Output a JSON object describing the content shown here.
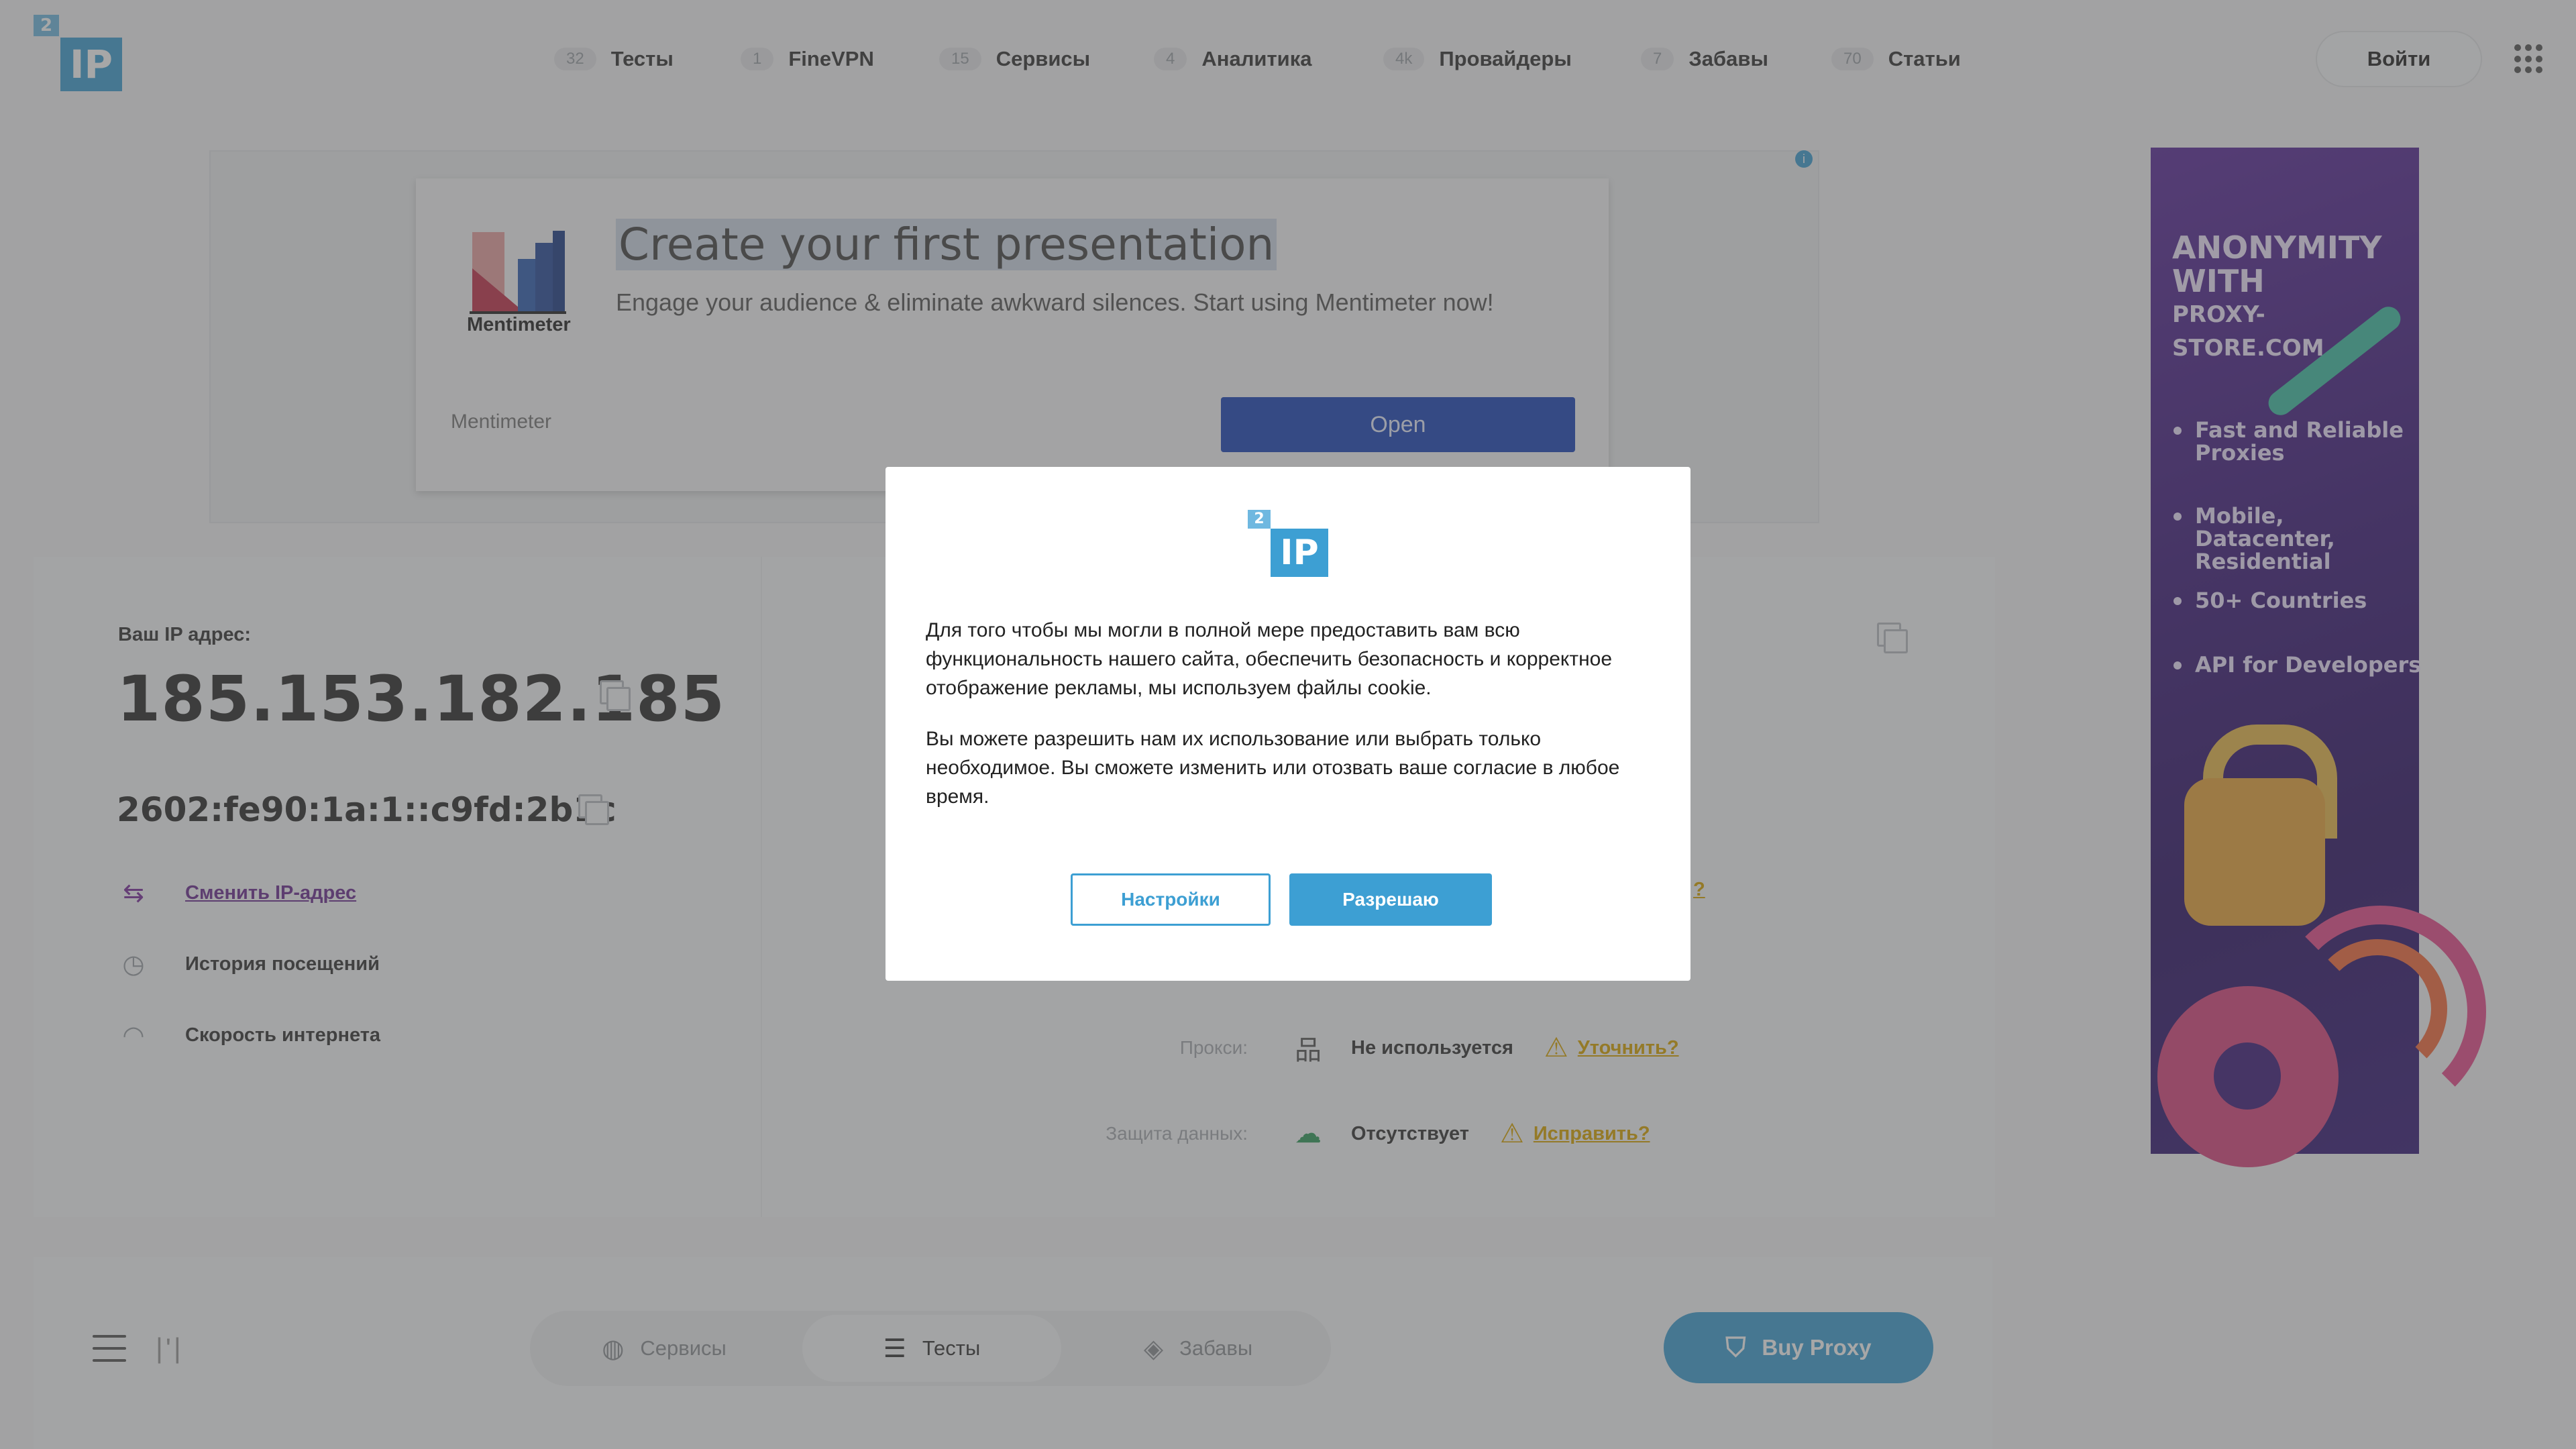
{
  "header": {
    "logo": {
      "superscript": "2",
      "mark": "IP"
    },
    "nav": [
      {
        "count": "32",
        "label": "Тесты"
      },
      {
        "count": "1",
        "label": "FineVPN"
      },
      {
        "count": "15",
        "label": "Сервисы"
      },
      {
        "count": "4",
        "label": "Аналитика"
      },
      {
        "count": "4k",
        "label": "Провайдеры"
      },
      {
        "count": "7",
        "label": "Забавы"
      },
      {
        "count": "70",
        "label": "Статьи"
      }
    ],
    "login_label": "Войти",
    "menu_icon": "grid-dots-icon"
  },
  "ad_top": {
    "title": "Create your first presentation",
    "description": "Engage your audience & eliminate awkward silences. Start using Mentimeter now!",
    "brand": "Mentimeter",
    "logo_text": "Mentimeter",
    "cta": "Open",
    "info_icon": "i"
  },
  "ip_card": {
    "label": "Ваш IP адрес:",
    "ipv4": "185.153.182.185",
    "ipv6": "2602:fe90:1a:1::c9fd:2b1c",
    "links": [
      {
        "label": "Сменить IP-адрес",
        "icon": "change-ip-icon"
      },
      {
        "label": "История посещений",
        "icon": "history-icon"
      },
      {
        "label": "Скорость интернета",
        "icon": "speedometer-icon"
      }
    ]
  },
  "info_rows": [
    {
      "label": "Прокси:",
      "value": "Не используется",
      "action": "Уточнить?",
      "icon": "network-icon"
    },
    {
      "label": "Защита данных:",
      "value": "Отсутствует",
      "action": "Исправить?",
      "icon": "cloud-lock-icon"
    }
  ],
  "partial_visible_link": "?",
  "ad_right": {
    "title_line1": "ANONYMITY",
    "title_line2": "WITH",
    "title_line3": "PROXY-STORE.COM",
    "bullets": [
      "Fast and Reliable Proxies",
      "Mobile, Datacenter, Residential",
      "50+ Countries",
      "API for Developers"
    ]
  },
  "bottom_bar": {
    "tabs": [
      {
        "label": "Сервисы",
        "icon": "globe-icon"
      },
      {
        "label": "Тесты",
        "icon": "sliders-icon"
      },
      {
        "label": "Забавы",
        "icon": "gamepad-icon"
      }
    ],
    "active_tab": "Тесты",
    "buy_proxy_label": "Buy Proxy"
  },
  "modal": {
    "logo": {
      "superscript": "2",
      "mark": "IP"
    },
    "paragraph1": "Для того чтобы мы могли в полной мере предоставить вам всю функциональность нашего сайта, обеспечить безопасность и корректное отображение рекламы, мы используем файлы cookie.",
    "paragraph2": "Вы можете разрешить нам их использование или выбрать только необходимое. Вы сможете изменить или отозвать ваше согласие в любое время.",
    "settings_label": "Настройки",
    "allow_label": "Разрешаю"
  },
  "colors": {
    "accent": "#3d9fd3",
    "warning": "#d9a400",
    "link_purple": "#6a2c91",
    "ad_button": "#1a44b8"
  }
}
